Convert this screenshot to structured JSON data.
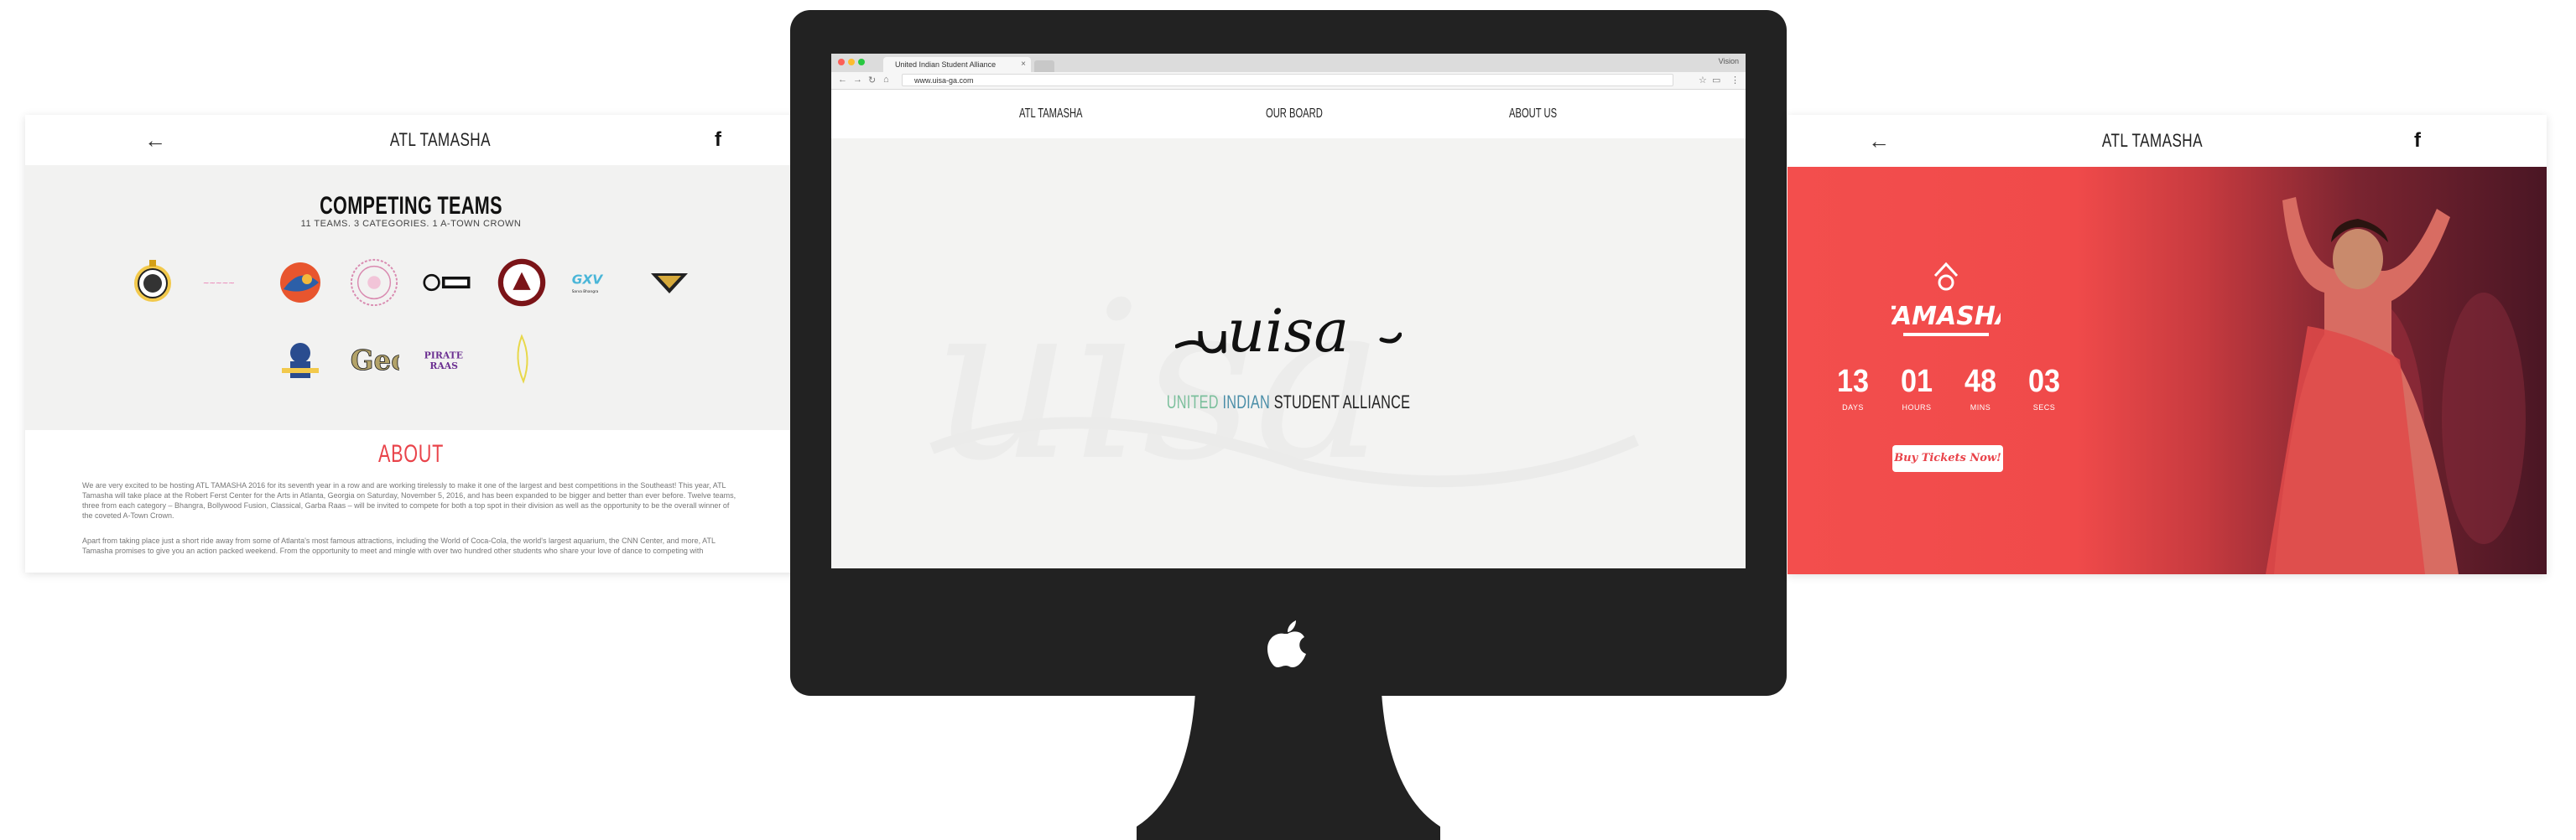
{
  "left_panel": {
    "header": {
      "title": "ATL TAMASHA",
      "back_icon": "arrow-left-icon",
      "social_icon": "facebook-icon"
    },
    "teams": {
      "title": "COMPETING TEAMS",
      "subtitle": "11 TEAMS. 3 CATEGORIES. 1 A-TOWN CROWN",
      "logo_wordmarks": [
        "Georgia Tech",
        "Pirate Raas",
        "Sarva Bhangra"
      ]
    },
    "about": {
      "title": "ABOUT",
      "paragraph1": "We are very excited to be hosting ATL TAMASHA 2016 for its seventh year in a row and are working tirelessly to make it one of the largest and best competitions in the Southeast! This year, ATL Tamasha will take place at the Robert Ferst Center for the Arts in Atlanta, Georgia on Saturday, November 5, 2016, and has been expanded to be bigger and better than ever before. Twelve teams, three from each category – Bhangra, Bollywood Fusion, Classical, Garba Raas – will be invited to compete for both a top spot in their division as well as the opportunity to be the overall winner of the coveted A-Town Crown.",
      "paragraph2": "Apart from taking place just a short ride away from some of Atlanta's most famous attractions, including the World of Coca-Cola, the world's largest aquarium, the CNN Center, and more, ATL Tamasha promises to give you an action packed weekend. From the opportunity to meet and mingle with over two hundred other students who share your love of dance to competing with"
    }
  },
  "browser": {
    "tab_title": "United Indian Student Alliance",
    "url": "www.uisa-ga.com",
    "user_label": "Vision"
  },
  "site": {
    "nav": [
      "ATL TAMASHA",
      "OUR BOARD",
      "ABOUT US"
    ],
    "logo_text": "uisa",
    "tagline": {
      "part1": "UNITED",
      "part2": "INDIAN",
      "part3": "STUDENT ALLIANCE"
    }
  },
  "right_panel": {
    "header": {
      "title": "ATL TAMASHA",
      "back_icon": "arrow-left-icon",
      "social_icon": "facebook-icon"
    },
    "logo_text": "TAMASHA",
    "countdown": [
      {
        "value": "13",
        "label": "DAYS"
      },
      {
        "value": "01",
        "label": "HOURS"
      },
      {
        "value": "48",
        "label": "MINS"
      },
      {
        "value": "03",
        "label": "SECS"
      }
    ],
    "button_label": "Buy Tickets Now!"
  },
  "colors": {
    "accent_red": "#e9434a",
    "monitor": "#222222",
    "tagline_green": "#7bbf9c",
    "tagline_blue": "#4a8ea8"
  }
}
